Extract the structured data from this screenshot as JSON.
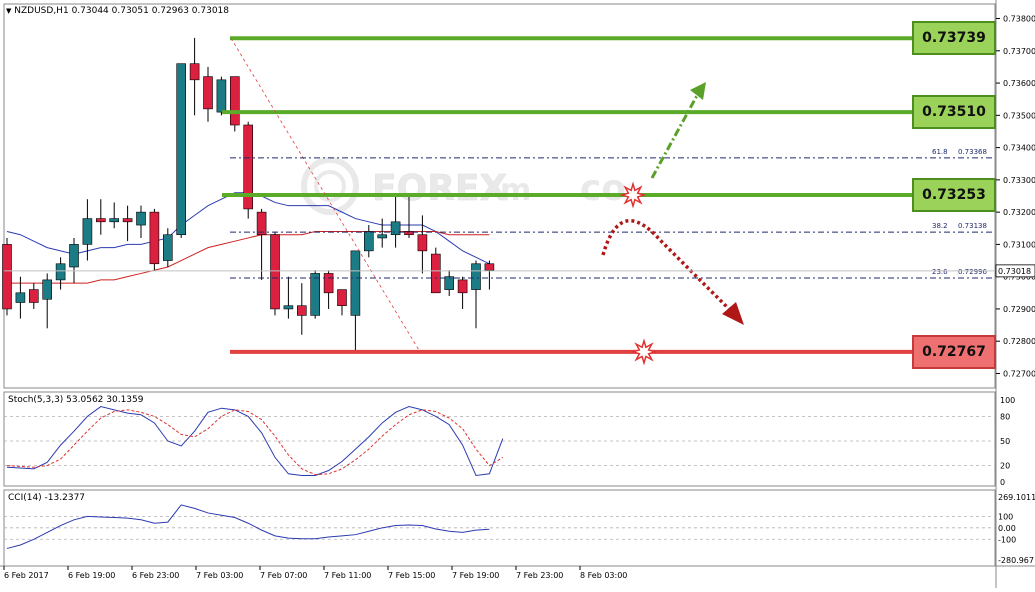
{
  "header": {
    "symbol": "NZDUSD,H1",
    "ohlc": "0.73044 0.73051 0.72963 0.73018"
  },
  "watermark": "FOREX",
  "watermark_suffix": "m",
  "watermark_tail": "co",
  "price_axis": {
    "labels": [
      "0.73800",
      "0.73700",
      "0.73600",
      "0.73500",
      "0.73400",
      "0.73300",
      "0.73200",
      "0.73100",
      "0.73000",
      "0.72900",
      "0.72800",
      "0.72700"
    ],
    "current_price": "0.73018"
  },
  "levels": [
    {
      "label": "0.73739",
      "value": 0.73739,
      "color": "#5aab28"
    },
    {
      "label": "0.73510",
      "value": 0.7351,
      "color": "#5aab28"
    },
    {
      "label": "0.73253",
      "value": 0.73253,
      "color": "#5aab28"
    },
    {
      "label": "0.72767",
      "value": 0.72767,
      "color": "#e04040"
    }
  ],
  "fibs": [
    {
      "label": "61.8",
      "value_label": "0.73368",
      "value": 0.73368
    },
    {
      "label": "38.2",
      "value_label": "0.73138",
      "value": 0.73138
    },
    {
      "label": "23.6",
      "value_label": "0.72996",
      "value": 0.72996
    }
  ],
  "stoch": {
    "title": "Stoch(5,3,3) 53.0562 30.1359",
    "axis_labels": [
      "100",
      "80",
      "50",
      "20",
      "0"
    ]
  },
  "cci": {
    "title": "CCI(14) -13.2377",
    "axis_labels": [
      "269.1011",
      "100",
      "0.00",
      "-100",
      "-280.967"
    ]
  },
  "time_labels": [
    "6 Feb 2017",
    "6 Feb 19:00",
    "6 Feb 23:00",
    "7 Feb 03:00",
    "7 Feb 07:00",
    "7 Feb 11:00",
    "7 Feb 15:00",
    "7 Feb 19:00",
    "7 Feb 23:00",
    "8 Feb 03:00"
  ],
  "chart_data": {
    "type": "candlestick",
    "title": "NZDUSD,H1",
    "ylim": [
      0.727,
      0.738
    ],
    "candles": [
      {
        "o": 0.731,
        "h": 0.7312,
        "l": 0.7288,
        "c": 0.729
      },
      {
        "o": 0.7292,
        "h": 0.73,
        "l": 0.7287,
        "c": 0.7295
      },
      {
        "o": 0.7296,
        "h": 0.7298,
        "l": 0.729,
        "c": 0.7292
      },
      {
        "o": 0.7293,
        "h": 0.7301,
        "l": 0.7284,
        "c": 0.7299
      },
      {
        "o": 0.7299,
        "h": 0.7306,
        "l": 0.7296,
        "c": 0.7304
      },
      {
        "o": 0.7303,
        "h": 0.7312,
        "l": 0.7298,
        "c": 0.731
      },
      {
        "o": 0.731,
        "h": 0.7324,
        "l": 0.7305,
        "c": 0.7318
      },
      {
        "o": 0.7318,
        "h": 0.7324,
        "l": 0.7313,
        "c": 0.7317
      },
      {
        "o": 0.7317,
        "h": 0.7323,
        "l": 0.7315,
        "c": 0.7318
      },
      {
        "o": 0.7318,
        "h": 0.7322,
        "l": 0.7311,
        "c": 0.7317
      },
      {
        "o": 0.7316,
        "h": 0.7322,
        "l": 0.7312,
        "c": 0.732
      },
      {
        "o": 0.732,
        "h": 0.7321,
        "l": 0.7302,
        "c": 0.7304
      },
      {
        "o": 0.7305,
        "h": 0.7315,
        "l": 0.7303,
        "c": 0.7313
      },
      {
        "o": 0.7313,
        "h": 0.7366,
        "l": 0.7312,
        "c": 0.7366
      },
      {
        "o": 0.7366,
        "h": 0.7374,
        "l": 0.735,
        "c": 0.7361
      },
      {
        "o": 0.7362,
        "h": 0.7365,
        "l": 0.7348,
        "c": 0.7352
      },
      {
        "o": 0.7351,
        "h": 0.7362,
        "l": 0.735,
        "c": 0.7361
      },
      {
        "o": 0.7362,
        "h": 0.7362,
        "l": 0.7345,
        "c": 0.7347
      },
      {
        "o": 0.7347,
        "h": 0.7348,
        "l": 0.7318,
        "c": 0.7321
      },
      {
        "o": 0.732,
        "h": 0.7321,
        "l": 0.7299,
        "c": 0.7313
      },
      {
        "o": 0.7313,
        "h": 0.7314,
        "l": 0.7288,
        "c": 0.729
      },
      {
        "o": 0.729,
        "h": 0.73,
        "l": 0.7287,
        "c": 0.7291
      },
      {
        "o": 0.7291,
        "h": 0.7298,
        "l": 0.7282,
        "c": 0.7288
      },
      {
        "o": 0.7288,
        "h": 0.7302,
        "l": 0.7287,
        "c": 0.7301
      },
      {
        "o": 0.7301,
        "h": 0.7302,
        "l": 0.729,
        "c": 0.7295
      },
      {
        "o": 0.7296,
        "h": 0.7296,
        "l": 0.7288,
        "c": 0.7291
      },
      {
        "o": 0.7288,
        "h": 0.7308,
        "l": 0.7277,
        "c": 0.7308
      },
      {
        "o": 0.7308,
        "h": 0.7316,
        "l": 0.7306,
        "c": 0.7314
      },
      {
        "o": 0.7312,
        "h": 0.7318,
        "l": 0.7309,
        "c": 0.7313
      },
      {
        "o": 0.7313,
        "h": 0.7325,
        "l": 0.7309,
        "c": 0.7317
      },
      {
        "o": 0.7314,
        "h": 0.7325,
        "l": 0.7312,
        "c": 0.7313
      },
      {
        "o": 0.7313,
        "h": 0.7319,
        "l": 0.7301,
        "c": 0.7308
      },
      {
        "o": 0.7307,
        "h": 0.7309,
        "l": 0.7295,
        "c": 0.7295
      },
      {
        "o": 0.7296,
        "h": 0.7302,
        "l": 0.7294,
        "c": 0.73
      },
      {
        "o": 0.7299,
        "h": 0.73,
        "l": 0.729,
        "c": 0.7295
      },
      {
        "o": 0.7296,
        "h": 0.7305,
        "l": 0.7284,
        "c": 0.7304
      },
      {
        "o": 0.7304,
        "h": 0.7305,
        "l": 0.7296,
        "c": 0.7302
      }
    ],
    "ma_blue": [
      0.7314,
      0.7313,
      0.7311,
      0.7309,
      0.7308,
      0.7307,
      0.7308,
      0.7309,
      0.7309,
      0.731,
      0.731,
      0.7311,
      0.7312,
      0.7316,
      0.7319,
      0.7322,
      0.7324,
      0.7326,
      0.7326,
      0.7325,
      0.7323,
      0.7322,
      0.7322,
      0.7322,
      0.7322,
      0.732,
      0.7318,
      0.7317,
      0.7316,
      0.7316,
      0.7316,
      0.7316,
      0.7314,
      0.7311,
      0.7308,
      0.7306,
      0.7304
    ],
    "ma_red": [
      0.7298,
      0.7298,
      0.7298,
      0.7298,
      0.7298,
      0.7298,
      0.7298,
      0.7299,
      0.7299,
      0.73,
      0.7301,
      0.7302,
      0.7303,
      0.7305,
      0.7307,
      0.7309,
      0.731,
      0.7311,
      0.7312,
      0.7313,
      0.7313,
      0.7313,
      0.7313,
      0.7314,
      0.7314,
      0.7314,
      0.7314,
      0.7314,
      0.7314,
      0.7314,
      0.7314,
      0.7314,
      0.7314,
      0.7313,
      0.7313,
      0.7313,
      0.7313
    ],
    "stoch_main": [
      18,
      17,
      16,
      24,
      45,
      62,
      80,
      92,
      88,
      84,
      82,
      72,
      50,
      44,
      62,
      85,
      90,
      88,
      80,
      60,
      30,
      10,
      8,
      8,
      14,
      25,
      40,
      55,
      72,
      85,
      92,
      88,
      80,
      70,
      45,
      8,
      10,
      53
    ],
    "stoch_signal": [
      20,
      19,
      18,
      20,
      28,
      45,
      62,
      78,
      86,
      88,
      85,
      80,
      70,
      58,
      55,
      65,
      80,
      88,
      86,
      76,
      56,
      33,
      16,
      9,
      10,
      16,
      27,
      40,
      56,
      70,
      82,
      88,
      86,
      78,
      65,
      40,
      20,
      30
    ],
    "cci": [
      -180,
      -150,
      -100,
      -40,
      20,
      70,
      100,
      95,
      90,
      85,
      70,
      40,
      50,
      200,
      170,
      130,
      110,
      90,
      40,
      -20,
      -70,
      -90,
      -95,
      -95,
      -80,
      -70,
      -60,
      -30,
      0,
      20,
      25,
      20,
      -10,
      -30,
      -40,
      -20,
      -13
    ]
  }
}
